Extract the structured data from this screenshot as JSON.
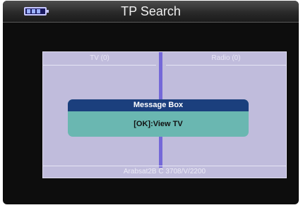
{
  "header": {
    "title": "TP Search",
    "battery_icon": "battery-icon"
  },
  "panel": {
    "tv_label": "TV (0)",
    "radio_label": "Radio (0)",
    "status": "Arabsat2B C 3708/V/2200"
  },
  "message_box": {
    "title": "Message Box",
    "message": "[OK]:View TV"
  },
  "colors": {
    "background": "#0d0d0d",
    "panel": "#c0bcdc",
    "divider": "#7468d8",
    "message_title_bg": "#1b3f7d",
    "message_body_bg": "#6ab7b1"
  }
}
